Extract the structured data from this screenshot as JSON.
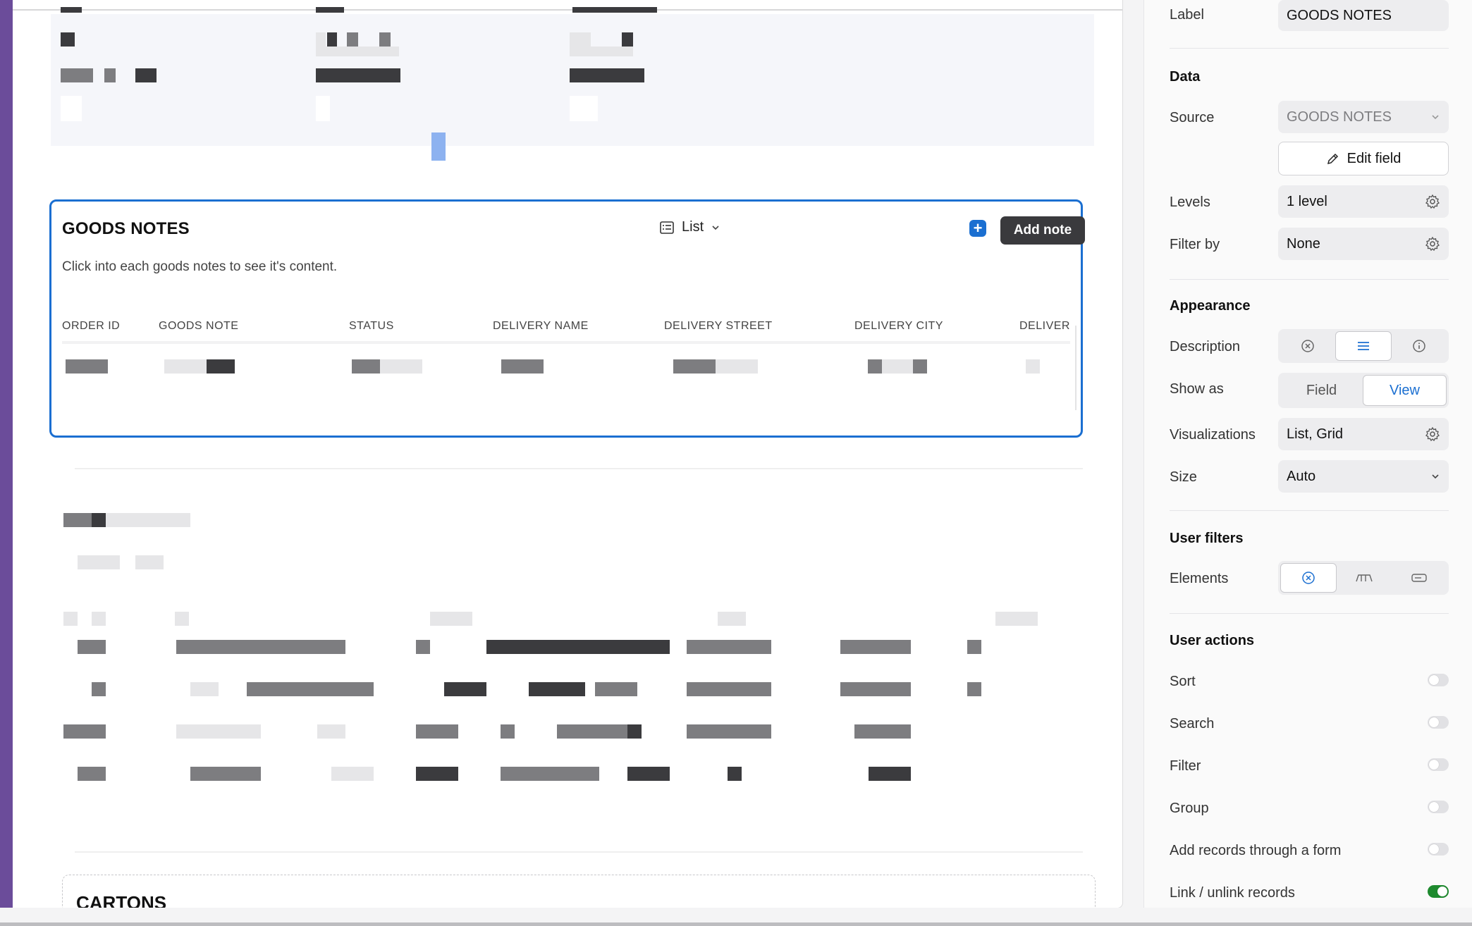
{
  "canvas": {
    "goods_block": {
      "title": "GOODS NOTES",
      "description": "Click into each goods notes to see it's content.",
      "view_selector": "List",
      "add_button": "Add note",
      "plus_glyph": "+",
      "columns": [
        "ORDER ID",
        "GOODS NOTE",
        "STATUS",
        "DELIVERY NAME",
        "DELIVERY STREET",
        "DELIVERY CITY",
        "DELIVER"
      ]
    },
    "cartons_block": {
      "title": "CARTONS"
    }
  },
  "panel": {
    "label_row": {
      "label": "Label",
      "value": "GOODS NOTES"
    },
    "data_section": {
      "title": "Data",
      "source": {
        "label": "Source",
        "value": "GOODS NOTES"
      },
      "edit_field": "Edit field",
      "levels": {
        "label": "Levels",
        "value": "1 level"
      },
      "filter_by": {
        "label": "Filter by",
        "value": "None"
      }
    },
    "appearance_section": {
      "title": "Appearance",
      "description": {
        "label": "Description",
        "active_index": 1
      },
      "show_as": {
        "label": "Show as",
        "options": [
          "Field",
          "View"
        ],
        "selected": "View"
      },
      "visualizations": {
        "label": "Visualizations",
        "value": "List, Grid"
      },
      "size": {
        "label": "Size",
        "value": "Auto"
      }
    },
    "user_filters_section": {
      "title": "User filters",
      "elements": {
        "label": "Elements",
        "active_index": 0
      }
    },
    "user_actions_section": {
      "title": "User actions",
      "toggles": [
        {
          "label": "Sort",
          "on": false
        },
        {
          "label": "Search",
          "on": false
        },
        {
          "label": "Filter",
          "on": false
        },
        {
          "label": "Group",
          "on": false
        },
        {
          "label": "Add records through a form",
          "on": false
        },
        {
          "label": "Link / unlink records",
          "on": true
        }
      ]
    }
  },
  "colors": {
    "accent": "#1b6fd1",
    "toggle_on": "#1e8a2e",
    "sidebar_purple": "#6b4c9a"
  }
}
